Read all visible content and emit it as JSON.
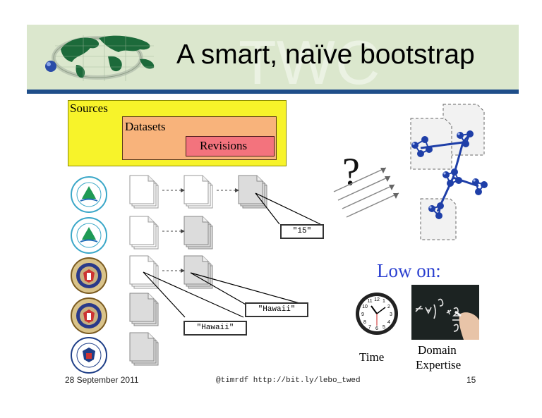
{
  "slide": {
    "title": "A smart, naïve bootstrap",
    "watermark": "TWC"
  },
  "hierarchy": {
    "sources": "Sources",
    "datasets": "Datasets",
    "revisions": "Revisions"
  },
  "callouts": {
    "c15": "\"15\"",
    "hawaii_a": "\"Hawaii\"",
    "hawaii_b": "\"Hawaii\""
  },
  "question_mark": "?",
  "right": {
    "low_on": "Low on:",
    "time": "Time",
    "domain": "Domain",
    "expertise": "Expertise"
  },
  "footer": {
    "date": "28 September 2011",
    "links": "@timrdf  http://bit.ly/lebo_twed",
    "page": "15"
  },
  "colors": {
    "header_bg": "#dbe7cd",
    "header_bar": "#1f4e8a",
    "sources": "#f7f32a",
    "datasets": "#f8b37b",
    "revisions": "#f3737d",
    "graph_node": "#1f3fa8",
    "low_on": "#2a3fd0"
  }
}
